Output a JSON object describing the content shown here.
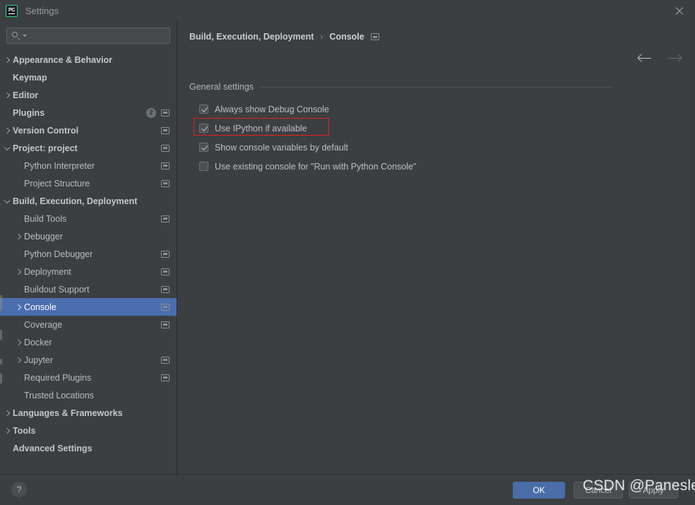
{
  "window": {
    "title": "Settings",
    "logo_text": "PC",
    "close_icon": "close-icon"
  },
  "search": {
    "value": "",
    "placeholder": ""
  },
  "sidebar": {
    "items": [
      {
        "label": "Appearance & Behavior",
        "arrow": "right",
        "indent": 0,
        "bold": true,
        "badge": "",
        "scope": false,
        "selected": false
      },
      {
        "label": "Keymap",
        "arrow": "none",
        "indent": 0,
        "bold": true,
        "badge": "",
        "scope": false,
        "selected": false
      },
      {
        "label": "Editor",
        "arrow": "right",
        "indent": 0,
        "bold": true,
        "badge": "",
        "scope": false,
        "selected": false
      },
      {
        "label": "Plugins",
        "arrow": "none",
        "indent": 0,
        "bold": true,
        "badge": "2",
        "scope": true,
        "selected": false
      },
      {
        "label": "Version Control",
        "arrow": "right",
        "indent": 0,
        "bold": true,
        "badge": "",
        "scope": true,
        "selected": false
      },
      {
        "label": "Project: project",
        "arrow": "down",
        "indent": 0,
        "bold": true,
        "badge": "",
        "scope": true,
        "selected": false
      },
      {
        "label": "Python Interpreter",
        "arrow": "none",
        "indent": 1,
        "bold": false,
        "badge": "",
        "scope": true,
        "selected": false
      },
      {
        "label": "Project Structure",
        "arrow": "none",
        "indent": 1,
        "bold": false,
        "badge": "",
        "scope": true,
        "selected": false
      },
      {
        "label": "Build, Execution, Deployment",
        "arrow": "down",
        "indent": 0,
        "bold": true,
        "badge": "",
        "scope": false,
        "selected": false
      },
      {
        "label": "Build Tools",
        "arrow": "none",
        "indent": 1,
        "bold": false,
        "badge": "",
        "scope": true,
        "selected": false
      },
      {
        "label": "Debugger",
        "arrow": "right",
        "indent": 1,
        "bold": false,
        "badge": "",
        "scope": false,
        "selected": false
      },
      {
        "label": "Python Debugger",
        "arrow": "none",
        "indent": 1,
        "bold": false,
        "badge": "",
        "scope": true,
        "selected": false
      },
      {
        "label": "Deployment",
        "arrow": "right",
        "indent": 1,
        "bold": false,
        "badge": "",
        "scope": true,
        "selected": false
      },
      {
        "label": "Buildout Support",
        "arrow": "none",
        "indent": 1,
        "bold": false,
        "badge": "",
        "scope": true,
        "selected": false
      },
      {
        "label": "Console",
        "arrow": "right",
        "indent": 1,
        "bold": false,
        "badge": "",
        "scope": true,
        "selected": true
      },
      {
        "label": "Coverage",
        "arrow": "none",
        "indent": 1,
        "bold": false,
        "badge": "",
        "scope": true,
        "selected": false
      },
      {
        "label": "Docker",
        "arrow": "right",
        "indent": 1,
        "bold": false,
        "badge": "",
        "scope": false,
        "selected": false
      },
      {
        "label": "Jupyter",
        "arrow": "right",
        "indent": 1,
        "bold": false,
        "badge": "",
        "scope": true,
        "selected": false
      },
      {
        "label": "Required Plugins",
        "arrow": "none",
        "indent": 1,
        "bold": false,
        "badge": "",
        "scope": true,
        "selected": false
      },
      {
        "label": "Trusted Locations",
        "arrow": "none",
        "indent": 1,
        "bold": false,
        "badge": "",
        "scope": false,
        "selected": false
      },
      {
        "label": "Languages & Frameworks",
        "arrow": "right",
        "indent": 0,
        "bold": true,
        "badge": "",
        "scope": false,
        "selected": false
      },
      {
        "label": "Tools",
        "arrow": "right",
        "indent": 0,
        "bold": true,
        "badge": "",
        "scope": false,
        "selected": false
      },
      {
        "label": "Advanced Settings",
        "arrow": "none",
        "indent": 0,
        "bold": true,
        "badge": "",
        "scope": false,
        "selected": false
      }
    ]
  },
  "main": {
    "breadcrumb": {
      "parent": "Build, Execution, Deployment",
      "separator": "›",
      "current": "Console",
      "scope_icon": "project-scope-icon"
    },
    "nav": {
      "back_icon": "arrow-left-icon",
      "forward_icon": "arrow-right-icon"
    },
    "section_title": "General settings",
    "checkboxes": [
      {
        "label": "Always show Debug Console",
        "checked": true,
        "highlighted": false
      },
      {
        "label": "Use IPython if available",
        "checked": true,
        "highlighted": true
      },
      {
        "label": "Show console variables by default",
        "checked": true,
        "highlighted": false
      },
      {
        "label": "Use existing console for \"Run with Python Console\"",
        "checked": false,
        "highlighted": false
      }
    ]
  },
  "footer": {
    "help_label": "?",
    "ok_label": "OK",
    "cancel_label": "Cancel",
    "apply_label": "Apply"
  },
  "overlay": {
    "watermark": "CSDN @Panesle"
  },
  "colors": {
    "accent": "#4a6da7",
    "selection": "#4b6eaf",
    "highlight": "#e52020",
    "background": "#3c3f41",
    "logo_border": "#21d789"
  }
}
